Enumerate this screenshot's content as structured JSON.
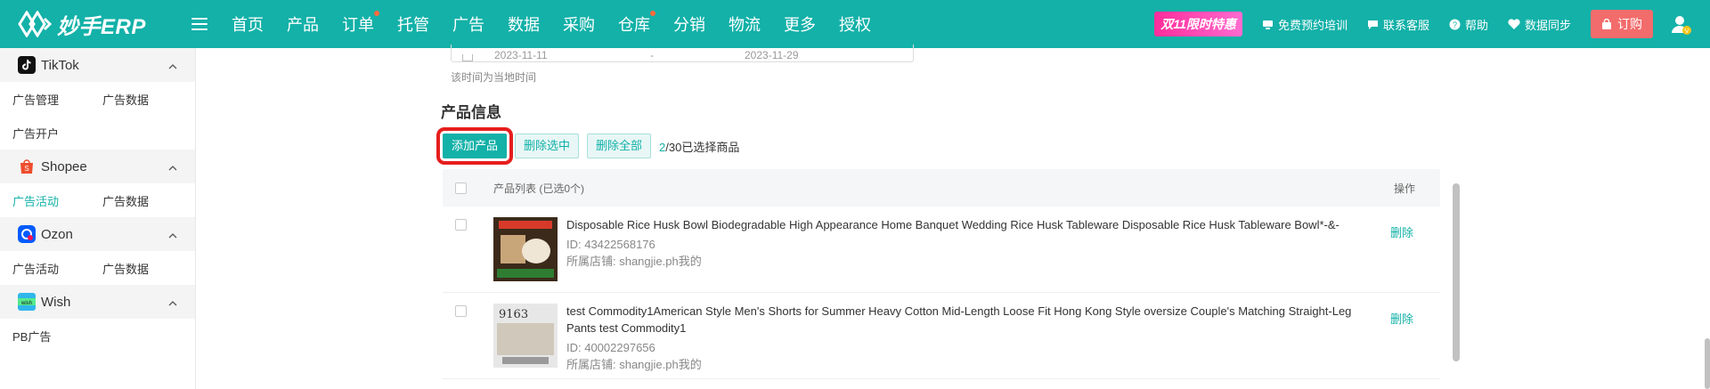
{
  "brand": {
    "name": "妙手ERP"
  },
  "nav": [
    {
      "label": "首页",
      "dot": false
    },
    {
      "label": "产品",
      "dot": false
    },
    {
      "label": "订单",
      "dot": true
    },
    {
      "label": "托管",
      "dot": false
    },
    {
      "label": "广告",
      "dot": false
    },
    {
      "label": "数据",
      "dot": false
    },
    {
      "label": "采购",
      "dot": false
    },
    {
      "label": "仓库",
      "dot": true
    },
    {
      "label": "分销",
      "dot": false
    },
    {
      "label": "物流",
      "dot": false
    },
    {
      "label": "更多",
      "dot": false
    },
    {
      "label": "授权",
      "dot": false
    }
  ],
  "tools": {
    "promo": "双11限时特惠",
    "training": "免费预约培训",
    "support": "联系客服",
    "help": "帮助",
    "sync": "数据同步",
    "order": "订购"
  },
  "sidebar": {
    "sections": [
      {
        "name": "TikTok",
        "icon": "tiktok-icon",
        "items": [
          "广告管理",
          "广告数据",
          "广告开户"
        ],
        "active": -1
      },
      {
        "name": "Shopee",
        "icon": "shopee-icon",
        "items": [
          "广告活动",
          "广告数据"
        ],
        "active": 0
      },
      {
        "name": "Ozon",
        "icon": "ozon-icon",
        "items": [
          "广告活动",
          "广告数据"
        ],
        "active": -1
      },
      {
        "name": "Wish",
        "icon": "wish-icon",
        "items": [
          "PB广告"
        ],
        "active": -1
      }
    ]
  },
  "main": {
    "date_start": "2023-11-11",
    "date_sep": "-",
    "date_end": "2023-11-29",
    "time_note": "该时间为当地时间",
    "section_title": "产品信息",
    "add_btn": "添加产品",
    "del_selected_btn": "删除选中",
    "del_all_btn": "删除全部",
    "sel_count": "2",
    "sel_suffix": "/30已选择商品",
    "table": {
      "col_name": "产品列表 (已选0个)",
      "col_op": "操作",
      "rows": [
        {
          "title": "Disposable Rice Husk Bowl Biodegradable High Appearance Home Banquet Wedding Rice Husk Tableware Disposable Rice Husk Tableware Bowl*-&-",
          "id": "ID: 43422568176",
          "shop": "所属店铺: shangjie.ph我的",
          "op": "删除"
        },
        {
          "title": "test Commodity1American Style Men's Shorts for Summer Heavy Cotton Mid-Length Loose Fit Hong Kong Style oversize Couple's Matching Straight-Leg Pants test Commodity1",
          "id": "ID: 40002297656",
          "shop": "所属店铺: shangjie.ph我的",
          "op": "删除"
        }
      ]
    }
  },
  "colors": {
    "brand": "#13b1a8",
    "promo": "#ff2d9b",
    "order": "#f36c6c",
    "highlight": "#e61e1e"
  }
}
